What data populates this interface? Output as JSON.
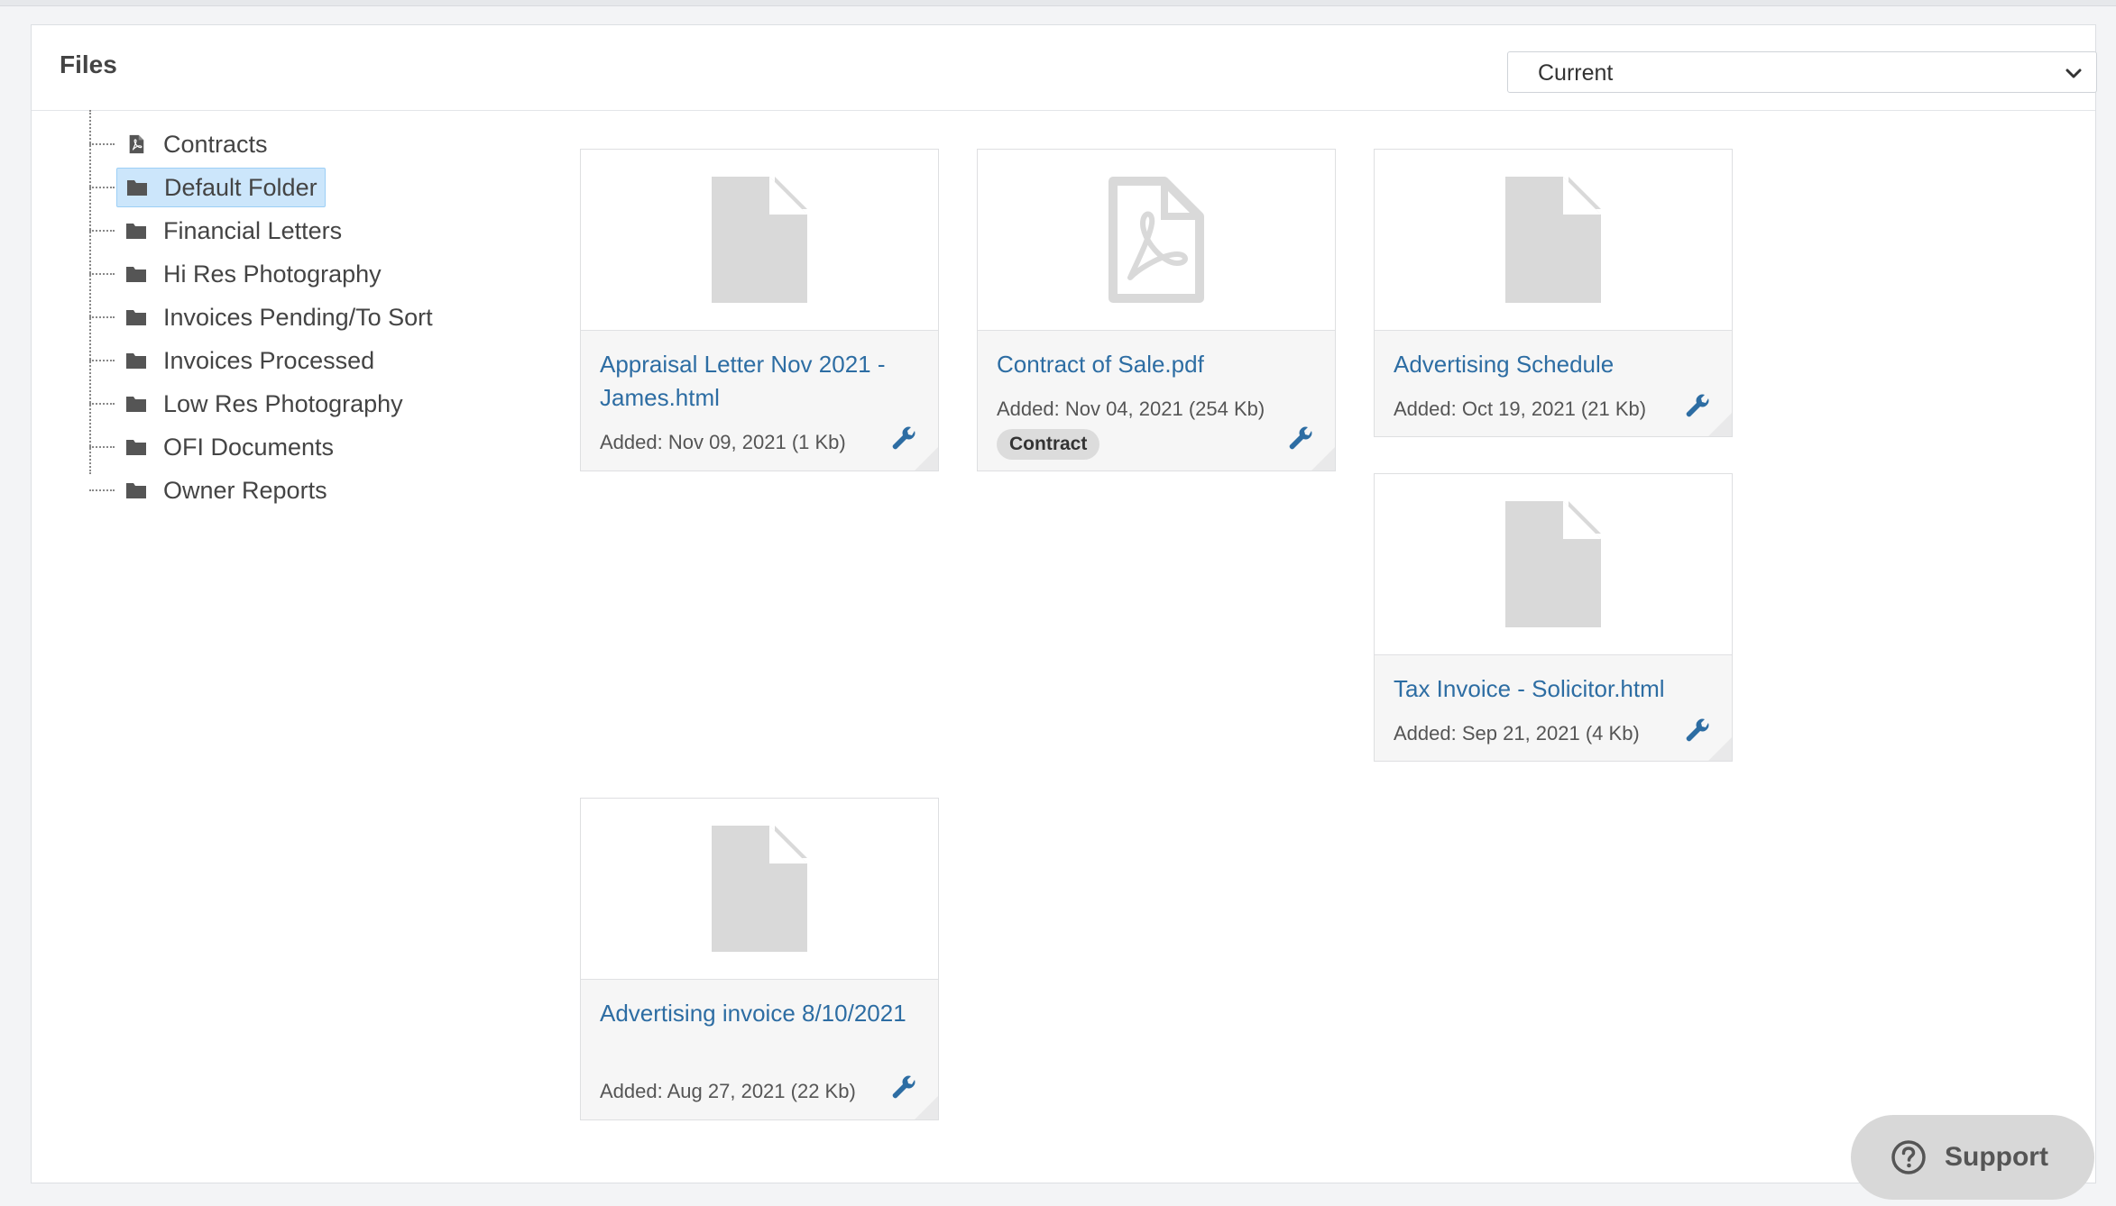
{
  "panel": {
    "title": "Files",
    "filter": {
      "selected": "Current"
    }
  },
  "tree": {
    "items": [
      {
        "label": "Contracts",
        "icon": "pdf-file-icon",
        "selected": false
      },
      {
        "label": "Default Folder",
        "icon": "folder-icon",
        "selected": true
      },
      {
        "label": "Financial Letters",
        "icon": "folder-icon",
        "selected": false
      },
      {
        "label": "Hi Res Photography",
        "icon": "folder-icon",
        "selected": false
      },
      {
        "label": "Invoices Pending/To Sort",
        "icon": "folder-icon",
        "selected": false
      },
      {
        "label": "Invoices Processed",
        "icon": "folder-icon",
        "selected": false
      },
      {
        "label": "Low Res Photography",
        "icon": "folder-icon",
        "selected": false
      },
      {
        "label": "OFI Documents",
        "icon": "folder-icon",
        "selected": false
      },
      {
        "label": "Owner Reports",
        "icon": "folder-icon",
        "selected": false
      }
    ]
  },
  "files": [
    {
      "name": "Appraisal Letter Nov 2021 - James.html",
      "meta": "Added: Nov 09, 2021 (1 Kb)",
      "icon": "document-icon",
      "tag": ""
    },
    {
      "name": "Contract of Sale.pdf",
      "meta": "Added: Nov 04, 2021 (254 Kb)",
      "icon": "pdf-document-icon",
      "tag": "Contract"
    },
    {
      "name": "Advertising Schedule",
      "meta": "Added: Oct 19, 2021 (21 Kb)",
      "icon": "document-icon",
      "tag": ""
    },
    {
      "name": "Tax Invoice - Solicitor.html",
      "meta": "Added: Sep 21, 2021 (4 Kb)",
      "icon": "document-icon",
      "tag": ""
    },
    {
      "name": "Advertising invoice 8/10/2021",
      "meta": "Added: Aug 27, 2021 (22 Kb)",
      "icon": "document-icon",
      "tag": ""
    }
  ],
  "support": {
    "label": "Support"
  },
  "colors": {
    "link": "#2d6da3",
    "selected_bg": "#cce6fb",
    "icon_gray": "#d9d9d9"
  }
}
